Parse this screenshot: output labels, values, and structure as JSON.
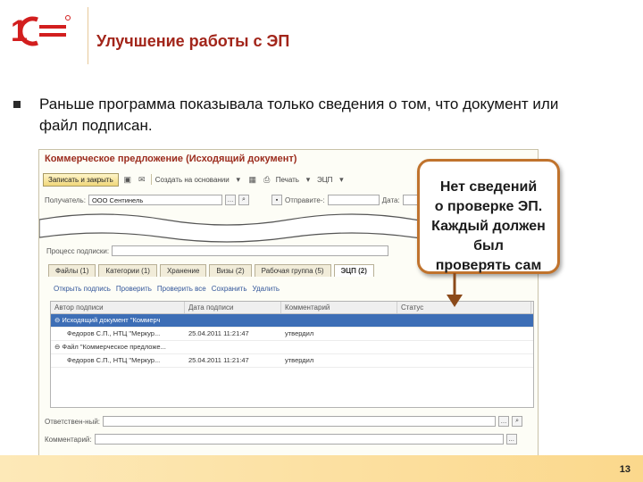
{
  "logo_text": "1С",
  "slide": {
    "title": "Улучшение работы с ЭП",
    "bullet": "Раньше программа показывала только сведения о том, что документ или файл подписан.",
    "page_number": "13"
  },
  "window": {
    "title": "Коммерческое предложение (Исходящий документ)",
    "toolbar": {
      "save_close": "Записать и закрыть",
      "create_basis": "Создать на основании",
      "print": "Печать",
      "ep": "ЭЦП"
    },
    "recipient_label": "Получатель:",
    "recipient_value": "ООО Сентинель",
    "sender_label": "Отправите-:",
    "date_label": "Дата:",
    "review_label": "Процесс подписки:",
    "tabs": [
      "Файлы (1)",
      "Категории (1)",
      "Хранение",
      "Визы (2)",
      "Рабочая группа (5)",
      "ЭЦП (2)"
    ],
    "sub_actions": [
      "Открыть подпись",
      "Проверить",
      "Проверить все",
      "Сохранить",
      "Удалить"
    ],
    "columns": [
      "Автор подписи",
      "Дата подписи",
      "Комментарий",
      "Статус"
    ],
    "rows": [
      {
        "author": "⊖ Исходящий документ \"Коммерч",
        "date": "",
        "comment": "",
        "status": "",
        "selected": true
      },
      {
        "author": "Федоров С.П., НТЦ \"Меркур...",
        "date": "25.04.2011 11:21:47",
        "comment": "утвердил",
        "status": "",
        "selected": false
      },
      {
        "author": "⊖ Файл \"Коммерческое предложе...",
        "date": "",
        "comment": "",
        "status": "",
        "selected": false
      },
      {
        "author": "Федоров С.П., НТЦ \"Меркур...",
        "date": "25.04.2011 11:21:47",
        "comment": "утвердил",
        "status": "",
        "selected": false
      }
    ],
    "responsible_label": "Ответствен-ный:",
    "comment_label": "Комментарий:"
  },
  "callout": {
    "lines": [
      "Нет сведений",
      "о проверке ЭП.",
      "Каждый должен был",
      "проверять сам"
    ]
  },
  "colors": {
    "title": "#a2251a",
    "callout_border": "#c0732d",
    "selected_row": "#3d6eb6"
  }
}
